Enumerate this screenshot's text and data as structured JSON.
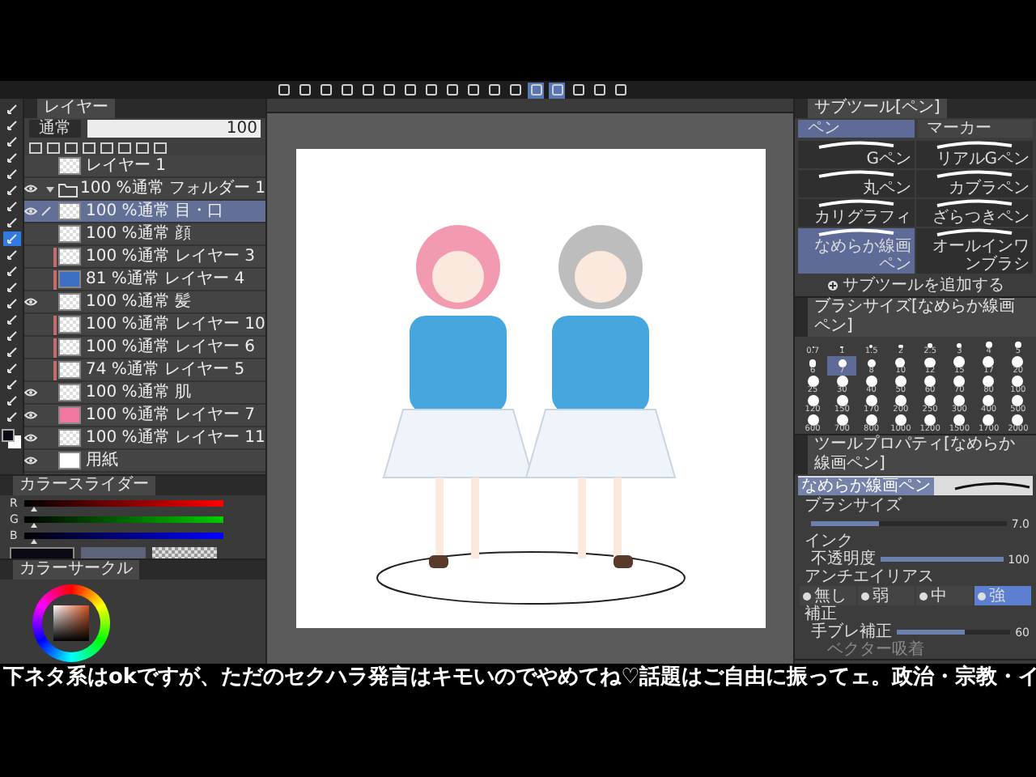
{
  "toolbar": {
    "buttons": [
      {
        "selected": false
      },
      {
        "selected": false
      },
      {
        "selected": false
      },
      {
        "selected": false
      },
      {
        "selected": false
      },
      {
        "selected": false
      },
      {
        "selected": false
      },
      {
        "selected": false
      },
      {
        "selected": false
      },
      {
        "selected": false
      },
      {
        "selected": false
      },
      {
        "selected": false
      },
      {
        "selected": true
      },
      {
        "selected": true
      },
      {
        "selected": false
      },
      {
        "selected": false
      },
      {
        "selected": false
      }
    ]
  },
  "tools": [
    {
      "selected": false
    },
    {
      "selected": false
    },
    {
      "selected": false
    },
    {
      "selected": false
    },
    {
      "selected": false
    },
    {
      "selected": false
    },
    {
      "selected": false
    },
    {
      "selected": false
    },
    {
      "selected": true
    },
    {
      "selected": false
    },
    {
      "selected": false
    },
    {
      "selected": false
    },
    {
      "selected": false
    },
    {
      "selected": false
    },
    {
      "selected": false
    },
    {
      "selected": false
    },
    {
      "selected": false
    },
    {
      "selected": false
    },
    {
      "selected": false
    },
    {
      "selected": false
    }
  ],
  "layers_panel": {
    "title": "レイヤー",
    "blend_mode": "通常",
    "opacity": {
      "value": "100",
      "level": 1
    },
    "layers": [
      {
        "kind": "layer",
        "name": "レイヤー 1",
        "visible": false,
        "selected": false,
        "clipped": false
      },
      {
        "kind": "folder",
        "mode": "100 %通常",
        "name": "フォルダー 1",
        "visible": true,
        "selected": false,
        "clipped": false,
        "expanded": true
      },
      {
        "kind": "layer",
        "mode": "100 %通常",
        "name": "目・口",
        "visible": true,
        "selected": true,
        "clipped": false
      },
      {
        "kind": "layer",
        "mode": "100 %通常",
        "name": "顔",
        "visible": false,
        "selected": false,
        "clipped": false
      },
      {
        "kind": "layer",
        "mode": "100 %通常",
        "name": "レイヤー 3",
        "visible": false,
        "selected": false,
        "clipped": true
      },
      {
        "kind": "sketch",
        "mode": "81 %通常",
        "name": "レイヤー 4",
        "visible": false,
        "selected": false,
        "clipped": true
      },
      {
        "kind": "layer",
        "mode": "100 %通常",
        "name": "髪",
        "visible": true,
        "selected": false,
        "clipped": false
      },
      {
        "kind": "layer",
        "mode": "100 %通常",
        "name": "レイヤー 10",
        "visible": false,
        "selected": false,
        "clipped": true
      },
      {
        "kind": "layer",
        "mode": "100 %通常",
        "name": "レイヤー 6",
        "visible": false,
        "selected": false,
        "clipped": true
      },
      {
        "kind": "layer",
        "mode": "74 %通常",
        "name": "レイヤー 5",
        "visible": false,
        "selected": false,
        "clipped": true
      },
      {
        "kind": "layer",
        "mode": "100 %通常",
        "name": "肌",
        "visible": true,
        "selected": false,
        "clipped": false
      },
      {
        "kind": "fill",
        "mode": "100 %通常",
        "name": "レイヤー 7",
        "visible": true,
        "selected": false,
        "clipped": false,
        "color": "#f0789e"
      },
      {
        "kind": "layer",
        "mode": "100 %通常",
        "name": "レイヤー 11",
        "visible": true,
        "selected": false,
        "clipped": false
      },
      {
        "kind": "paper",
        "name": "用紙",
        "visible": true,
        "selected": false,
        "clipped": false
      }
    ]
  },
  "color_slider": {
    "title": "カラースライダー",
    "channels": [
      {
        "label": "R",
        "level": 0.03
      },
      {
        "label": "G",
        "level": 0.03
      },
      {
        "label": "B",
        "level": 0.03
      }
    ]
  },
  "color_circle": {
    "title": "カラーサークル"
  },
  "subtool_panel": {
    "title": "サブツール[ペン]",
    "groups": [
      {
        "label": "ペン",
        "selected": true
      },
      {
        "label": "マーカー",
        "selected": false
      }
    ],
    "brushes": [
      {
        "label": "Gペン",
        "selected": false
      },
      {
        "label": "リアルGペン",
        "selected": false
      },
      {
        "label": "丸ペン",
        "selected": false
      },
      {
        "label": "カブラペン",
        "selected": false
      },
      {
        "label": "カリグラフィ",
        "selected": false
      },
      {
        "label": "ざらつきペン",
        "selected": false
      },
      {
        "label": "なめらか線画ペン",
        "selected": true
      },
      {
        "label": "オールインワンブラシ",
        "selected": false
      }
    ],
    "add_label": "サブツールを追加する"
  },
  "brush_size_panel": {
    "title": "ブラシサイズ[なめらか線画ペン]",
    "sizes": [
      {
        "label": "0.7",
        "selected": false
      },
      {
        "label": "1",
        "selected": false
      },
      {
        "label": "1.5",
        "selected": false
      },
      {
        "label": "2",
        "selected": false
      },
      {
        "label": "2.5",
        "selected": false
      },
      {
        "label": "3",
        "selected": false
      },
      {
        "label": "4",
        "selected": false
      },
      {
        "label": "5",
        "selected": false
      },
      {
        "label": "6",
        "selected": false
      },
      {
        "label": "7",
        "selected": true
      },
      {
        "label": "8",
        "selected": false
      },
      {
        "label": "10",
        "selected": false
      },
      {
        "label": "12",
        "selected": false
      },
      {
        "label": "15",
        "selected": false
      },
      {
        "label": "17",
        "selected": false
      },
      {
        "label": "20",
        "selected": false
      },
      {
        "label": "25",
        "selected": false
      },
      {
        "label": "30",
        "selected": false
      },
      {
        "label": "40",
        "selected": false
      },
      {
        "label": "50",
        "selected": false
      },
      {
        "label": "60",
        "selected": false
      },
      {
        "label": "70",
        "selected": false
      },
      {
        "label": "80",
        "selected": false
      },
      {
        "label": "100",
        "selected": false
      },
      {
        "label": "120",
        "selected": false
      },
      {
        "label": "150",
        "selected": false
      },
      {
        "label": "170",
        "selected": false
      },
      {
        "label": "200",
        "selected": false
      },
      {
        "label": "250",
        "selected": false
      },
      {
        "label": "300",
        "selected": false
      },
      {
        "label": "400",
        "selected": false
      },
      {
        "label": "500",
        "selected": false
      },
      {
        "label": "600",
        "selected": false
      },
      {
        "label": "700",
        "selected": false
      },
      {
        "label": "800",
        "selected": false
      },
      {
        "label": "1000",
        "selected": false
      },
      {
        "label": "1200",
        "selected": false
      },
      {
        "label": "1500",
        "selected": false
      },
      {
        "label": "1700",
        "selected": false
      },
      {
        "label": "2000",
        "selected": false
      }
    ]
  },
  "tool_property": {
    "title": "ツールプロパティ[なめらか線画ペン]",
    "preview_label": "なめらか線画ペン",
    "brush_size": {
      "label": "ブラシサイズ",
      "value": "7.0",
      "level": 0.35
    },
    "ink_label": "インク",
    "opacity": {
      "label": "不透明度",
      "value": "100",
      "level": 1
    },
    "antialias": {
      "label": "アンチエイリアス",
      "options": [
        {
          "label": "無し",
          "selected": false
        },
        {
          "label": "弱",
          "selected": false
        },
        {
          "label": "中",
          "selected": false
        },
        {
          "label": "強",
          "selected": true
        }
      ]
    },
    "correction_label": "補正",
    "stabilization": {
      "label": "手ブレ補正",
      "value": "60",
      "level": 0.6
    },
    "vector_snap_label": "ベクター吸着"
  },
  "caption": "下ネタ系はokですが、ただのセクハラ発言はキモいのでやめてね♡話題はご自由に振ってェ。政治・宗教・イ"
}
